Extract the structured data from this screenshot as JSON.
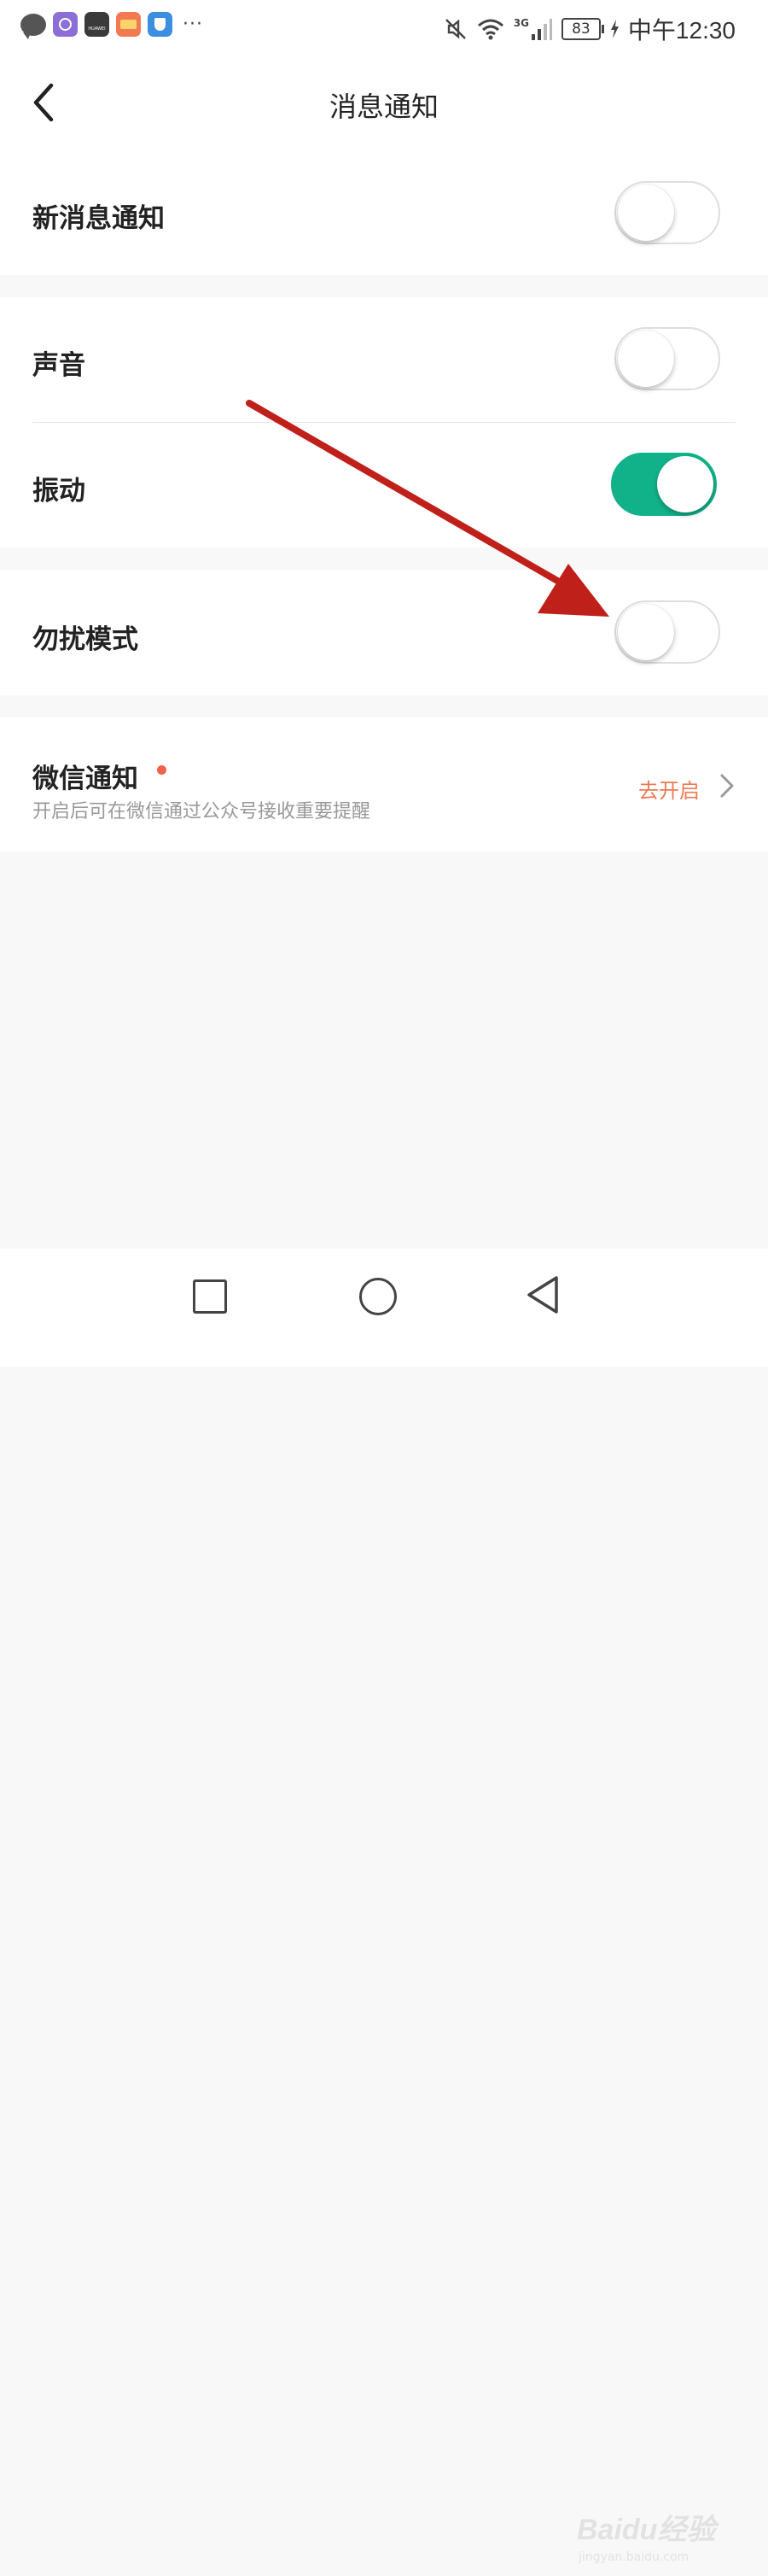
{
  "status_bar": {
    "battery": "83",
    "network": "3G",
    "time": "中午12:30",
    "notification_icons": [
      "chat-icon",
      "purple-app-icon",
      "huawei-icon",
      "wallet-icon",
      "shield-icon"
    ],
    "huawei_icon_text": "HUAWEI"
  },
  "header": {
    "title": "消息通知"
  },
  "settings": {
    "new_message": {
      "label": "新消息通知",
      "on": false
    },
    "sound": {
      "label": "声音",
      "on": false
    },
    "vibration": {
      "label": "振动",
      "on": true
    },
    "dnd": {
      "label": "勿扰模式",
      "on": false
    }
  },
  "wechat": {
    "title": "微信通知",
    "subtitle": "开启后可在微信通过公众号接收重要提醒",
    "action": "去开启"
  },
  "watermark": {
    "brand": "Baidu经验",
    "url": "jingyan.baidu.com"
  },
  "colors": {
    "toggle_on": "#11b28a",
    "accent_orange": "#ed7a53",
    "dot_red": "#f0624c",
    "annotation_arrow": "#c0201a"
  }
}
